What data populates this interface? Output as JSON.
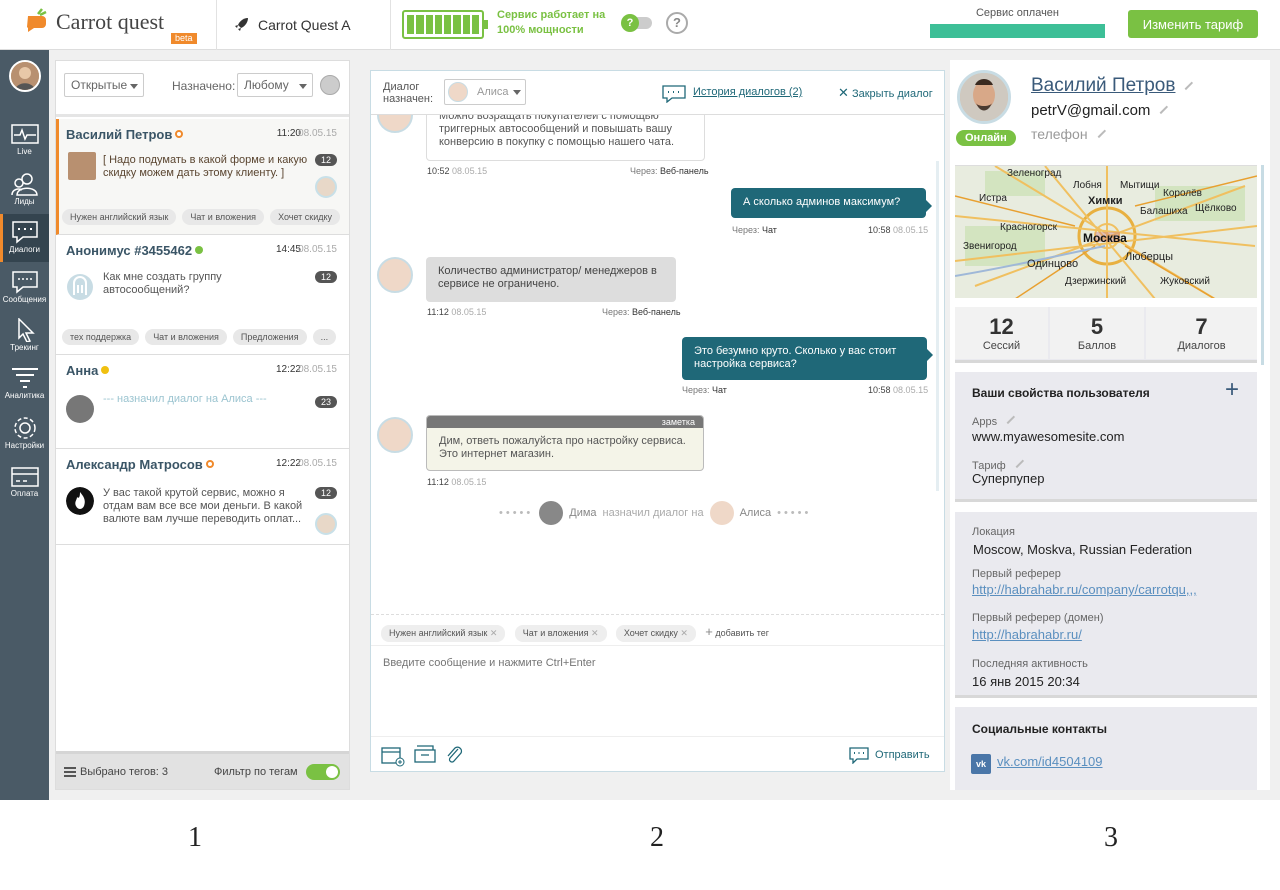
{
  "topbar": {
    "brand": "Carrot quest",
    "beta": "beta",
    "app_name": "Carrot Quest A",
    "service_status": "Сервис работает на 100% мощности",
    "help_glyph": "?",
    "question_glyph": "?",
    "paid_label": "Сервис оплачен",
    "change_tariff": "Изменить тариф",
    "accent_green": "#7ac143",
    "accent_orange": "#f08a2c"
  },
  "sidebar": {
    "items": [
      {
        "label": "Live",
        "icon": "pulse-icon"
      },
      {
        "label": "Лиды",
        "icon": "people-icon"
      },
      {
        "label": "Диалоги",
        "icon": "dialogs-icon"
      },
      {
        "label": "Сообщения",
        "icon": "messages-icon"
      },
      {
        "label": "Трекинг",
        "icon": "cursor-icon"
      },
      {
        "label": "Аналитика",
        "icon": "funnel-icon"
      },
      {
        "label": "Настройки",
        "icon": "gear-icon"
      },
      {
        "label": "Оплата",
        "icon": "card-icon"
      }
    ]
  },
  "list": {
    "filter_status": "Открытые",
    "assigned_label": "Назначено:",
    "assigned_value": "Любому",
    "conversations": [
      {
        "name": "Василий Петров",
        "time": "11:20",
        "date": "08.05.15",
        "message": "[ Надо подумать в какой форме и какую скидку можем дать этому клиенту. ]",
        "count": "12",
        "tags": [
          "Нужен английский язык",
          "Чат и вложения",
          "Хочет скидку"
        ]
      },
      {
        "name": "Анонимус #3455462",
        "time": "14:45",
        "date": "08.05.15",
        "message": "Как мне создать группу автосообщений?",
        "count": "12",
        "tags": [
          "тех поддержка",
          "Чат и вложения",
          "Предложения",
          "..."
        ]
      },
      {
        "name": "Анна",
        "time": "12:22",
        "date": "08.05.15",
        "message": "--- назначил диалог на Алиса ---",
        "count": "23"
      },
      {
        "name": "Александр Матросов",
        "time": "12:22",
        "date": "08.05.15",
        "message": "У вас такой крутой сервис, можно я отдам вам все все мои деньги. В какой валюте вам лучше переводить оплат...",
        "count": "12"
      }
    ],
    "footer_tags": "Выбрано тегов: 3",
    "footer_filter": "Фильтр по тегам"
  },
  "chat": {
    "assigned_label": "Диалог назначен:",
    "assignee": "Алиса",
    "history": "История диалогов (2)",
    "close": "Закрыть диалог",
    "messages": [
      {
        "text": "Можно возращать покупателей с помощью триггерных автосообщений и повышать вашу конверсию в покупку с помощью нашего чата.",
        "time": "10:52",
        "date": "08.05.15",
        "via_label": "Через:",
        "via": "Веб-панель"
      },
      {
        "text": "А сколько админов максимум?",
        "time": "10:58",
        "date": "08.05.15",
        "via_label": "Через:",
        "via": "Чат"
      },
      {
        "text": "Количество администратор/ менеджеров в сервисе не ограничено.",
        "time": "11:12",
        "date": "08.05.15",
        "via_label": "Через:",
        "via": "Веб-панель"
      },
      {
        "text": "Это безумно круто. Сколько у вас стоит настройка сервиса?",
        "time": "10:58",
        "date": "08.05.15",
        "via_label": "Через:",
        "via": "Чат"
      },
      {
        "text": "Дим, ответь пожалуйста про настройку сервиса. Это интернет магазин.",
        "time": "11:12",
        "date": "08.05.15",
        "note_label": "заметка"
      }
    ],
    "system": {
      "from": "Дима",
      "action": "назначил диалог на",
      "to": "Алиса"
    },
    "tags": [
      "Нужен английский язык",
      "Чат и вложения",
      "Хочет скидку"
    ],
    "add_tag": "добавить тег",
    "input_placeholder": "Введите сообщение и нажмите Ctrl+Enter",
    "send": "Отправить"
  },
  "profile": {
    "name": "Василий Петров",
    "email": "petrV@gmail.com",
    "phone": "телефон",
    "online": "Онлайн",
    "map_labels": [
      "Зеленоград",
      "Лобня",
      "Мытищи",
      "Королёв",
      "Истра",
      "Химки",
      "Балашиха",
      "Щёлково",
      "Красногорск",
      "Москва",
      "Звенигород",
      "Люберцы",
      "Одинцово",
      "Жуковский",
      "Дзержинский"
    ],
    "stats": [
      {
        "value": "12",
        "label": "Сессий"
      },
      {
        "value": "5",
        "label": "Баллов"
      },
      {
        "value": "7",
        "label": "Диалогов"
      }
    ],
    "props_title": "Ваши свойства пользователя",
    "apps_label": "Apps",
    "apps_value": "www.myawesomesite.com",
    "tariff_label": "Тариф",
    "tariff_value": "Суперпупер",
    "location_label": "Локация",
    "location_value": "Moscow, Moskva, Russian Federation",
    "referrer_label": "Первый реферер",
    "referrer_value": "http://habrahabr.ru/company/carrotqu,,,",
    "referrer_domain_label": "Первый реферер (домен)",
    "referrer_domain_value": "http://habrahabr.ru/",
    "last_activity_label": "Последняя активность",
    "last_activity_value": "16 янв 2015 20:34",
    "social_title": "Социальные контакты",
    "vk": "vk.com/id4504109"
  },
  "figure_numbers": [
    "1",
    "2",
    "3"
  ]
}
